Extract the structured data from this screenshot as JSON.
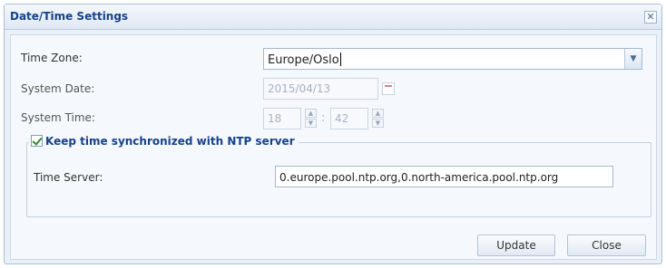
{
  "dialog": {
    "title": "Date/Time Settings",
    "close_glyph": "✕"
  },
  "timezone": {
    "label": "Time Zone:",
    "value": "Europe/Oslo",
    "dropdown_glyph": "▼"
  },
  "system_date": {
    "label": "System Date:",
    "value": "2015/04/13"
  },
  "system_time": {
    "label": "System Time:",
    "hour": "18",
    "separator": ":",
    "minute": "42"
  },
  "ntp": {
    "checkbox_label": "Keep time synchronized with NTP server",
    "checked": true,
    "server_label": "Time Server:",
    "server_value": "0.europe.pool.ntp.org,0.north-america.pool.ntp.org"
  },
  "buttons": {
    "update": "Update",
    "close": "Close"
  },
  "icons": {
    "close": "close-icon",
    "dropdown": "chevron-down-icon",
    "calendar": "calendar-icon",
    "spinner": "spinner-icon",
    "checkbox": "checkbox-icon"
  },
  "colors": {
    "title": "#15428b",
    "accent_border": "#a9bfd6",
    "panel_bg": "#f5f8fc"
  }
}
